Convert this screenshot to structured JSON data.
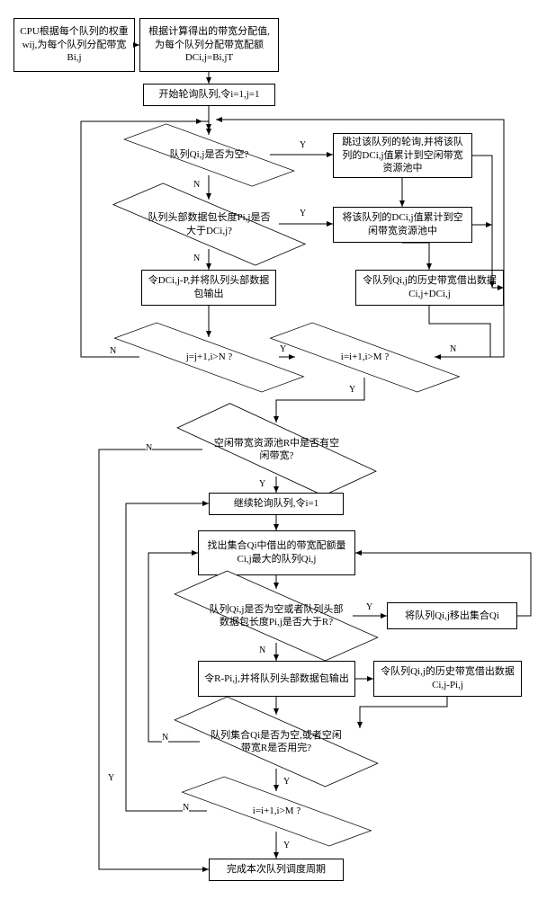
{
  "flow": {
    "start": "CPU根据每个队列的权重wij,为每个队列分配带宽Bi,j",
    "b2": "根据计算得出的带宽分配值,为每个队列分配带宽配额DCi,j=Bi,jT",
    "b3": "开始轮询队列,令i=1,j=1",
    "d1": "队列Qi,j是否为空?",
    "b4": "跳过该队列的轮询,并将该队列的DCi,j值累计到空闲带宽资源池中",
    "d2": "队列头部数据包长度Pi,j是否大于DCi,j?",
    "b5": "将该队列的DCi,j值累计到空闲带宽资源池中",
    "b6": "令DCi,j-P,并将队列头部数据包输出",
    "b7": "令队列Qi,j的历史带宽借出数据Ci,j+DCi,j",
    "d3": "j=j+1,i>N ?",
    "d4": "i=i+1,i>M ?",
    "d5": "空闲带宽资源池R中是否有空闲带宽?",
    "b8": "继续轮询队列,令i=1",
    "b9": "找出集合Qi中借出的带宽配额量Ci,j最大的队列Qi,j",
    "d6": "队列Qi,j是否为空或者队列头部数据包长度Pi,j是否大于R?",
    "b10": "将队列Qi,j移出集合Qi",
    "b11": "令R-Pi,j,并将队列头部数据包输出",
    "b12": "令队列Qi,j的历史带宽借出数据Ci,j-Pi,j",
    "d7": "队列集合Qi是否为空,或者空闲带宽R是否用完?",
    "d8": "i=i+1,i>M ?",
    "end": "完成本次队列调度周期"
  },
  "labels": {
    "Y": "Y",
    "N": "N"
  }
}
